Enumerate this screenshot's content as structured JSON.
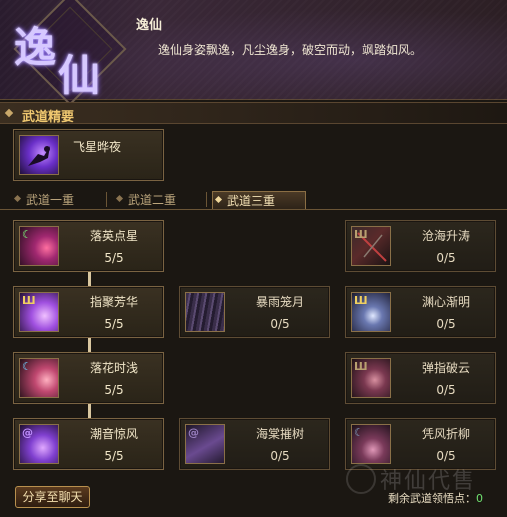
{
  "header": {
    "emblem_char1": "逸",
    "emblem_char2": "仙",
    "title": "逸仙",
    "description": "逸仙身姿飘逸，凡尘逸身，破空而动，飒踏如风。"
  },
  "section": {
    "label": "武道精要"
  },
  "essence_skill": {
    "name": "飞星晔夜"
  },
  "tabs": [
    {
      "label": "武道一重"
    },
    {
      "label": "武道二重"
    },
    {
      "label": "武道三重",
      "active": true
    }
  ],
  "skills": {
    "r1c1": {
      "name": "落英点星",
      "count": "5/5"
    },
    "r1c3": {
      "name": "沧海升涛",
      "count": "0/5"
    },
    "r2c1": {
      "name": "指聚芳华",
      "count": "5/5"
    },
    "r2c2": {
      "name": "暴雨笼月",
      "count": "0/5"
    },
    "r2c3": {
      "name": "渊心渐明",
      "count": "0/5"
    },
    "r3c1": {
      "name": "落花时浅",
      "count": "5/5"
    },
    "r3c3": {
      "name": "弹指破云",
      "count": "0/5"
    },
    "r4c1": {
      "name": "潮音惊风",
      "count": "5/5"
    },
    "r4c2": {
      "name": "海棠摧树",
      "count": "0/5"
    },
    "r4c3": {
      "name": "凭风折柳",
      "count": "0/5"
    }
  },
  "footer": {
    "share_label": "分享至聊天",
    "remaining_label": "剩余武道领悟点：",
    "remaining_value": "0",
    "watermark": "神仙代售"
  },
  "colors": {
    "accent_gold": "#f0c870",
    "remaining_green": "#6fe06f",
    "icon_purple": "#9b5cff"
  }
}
